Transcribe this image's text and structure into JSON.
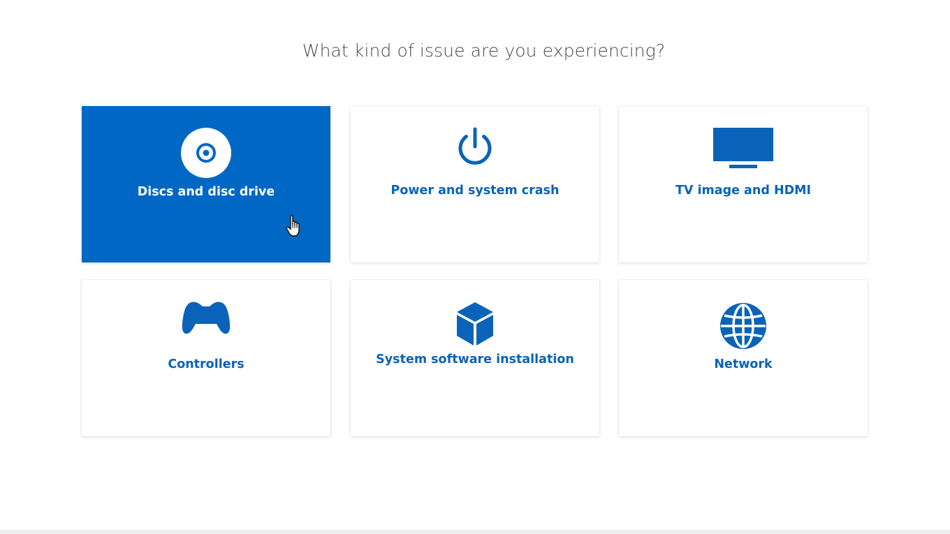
{
  "page": {
    "heading": "What kind of issue are you experiencing?"
  },
  "cards": [
    {
      "id": "discs",
      "label": "Discs and disc drive",
      "icon": "disc-icon",
      "selected": true
    },
    {
      "id": "power",
      "label": "Power and system crash",
      "icon": "power-icon",
      "selected": false
    },
    {
      "id": "tv",
      "label": "TV image and HDMI",
      "icon": "tv-icon",
      "selected": false
    },
    {
      "id": "controllers",
      "label": "Controllers",
      "icon": "controller-icon",
      "selected": false
    },
    {
      "id": "system_software",
      "label": "System software installation",
      "icon": "cube-icon",
      "selected": false
    },
    {
      "id": "network",
      "label": "Network",
      "icon": "globe-icon",
      "selected": false
    }
  ],
  "colors": {
    "accent": "#0068c4",
    "label_blue": "#0a63b8",
    "heading_text": "#4a4a4a",
    "background": "#ffffff"
  }
}
